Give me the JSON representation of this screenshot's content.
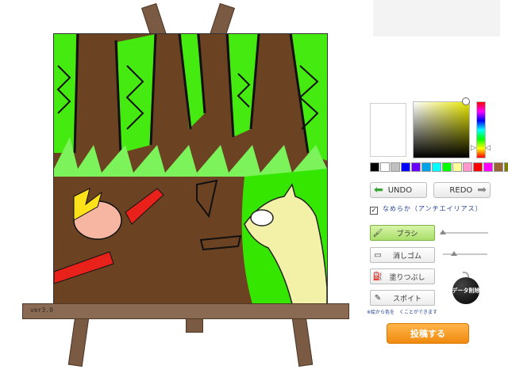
{
  "canvas": {
    "version": "ver3.0"
  },
  "palette": {
    "colors": [
      "#000000",
      "#ffffff",
      "#c0c0c0",
      "#0000ff",
      "#6a00ff",
      "#00a2e8",
      "#00ffff",
      "#00ff00",
      "#ffff99",
      "#ff99cc",
      "#ff0000",
      "#ff00ff",
      "#996633",
      "#808000",
      "#000000"
    ]
  },
  "controls": {
    "undo": "UNDO",
    "redo": "REDO",
    "antialias_label": "なめらか（アンチエイリアス）",
    "antialias_checked": "✓",
    "tools": {
      "brush": "ブラシ",
      "eraser": "消しゴム",
      "fill": "塗りつぶし",
      "dropper": "スポイト"
    },
    "dropper_note": "※絵から色を　くことができます",
    "clear": "データ削除",
    "submit": "投稿する"
  },
  "colors": {
    "accent_orange": "#f39a1e",
    "active_tool": "#b8e27a",
    "label_blue": "#1f3f8f"
  }
}
